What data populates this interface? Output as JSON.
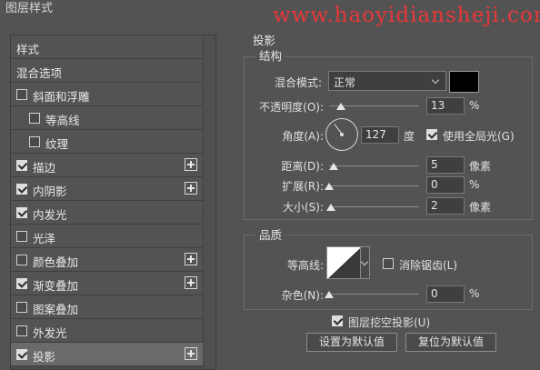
{
  "dialog": {
    "title": "图层样式",
    "watermark": "www.haoyidiansheji.com"
  },
  "style_list": [
    {
      "label": "样式",
      "has_checkbox": false,
      "checked": false,
      "has_plus": false,
      "selected": false,
      "indent": 0
    },
    {
      "label": "混合选项",
      "has_checkbox": false,
      "checked": false,
      "has_plus": false,
      "selected": false,
      "indent": 0
    },
    {
      "label": "斜面和浮雕",
      "has_checkbox": true,
      "checked": false,
      "has_plus": false,
      "selected": false,
      "indent": 0
    },
    {
      "label": "等高线",
      "has_checkbox": true,
      "checked": false,
      "has_plus": false,
      "selected": false,
      "indent": 1
    },
    {
      "label": "纹理",
      "has_checkbox": true,
      "checked": false,
      "has_plus": false,
      "selected": false,
      "indent": 1
    },
    {
      "label": "描边",
      "has_checkbox": true,
      "checked": true,
      "has_plus": true,
      "selected": false,
      "indent": 0
    },
    {
      "label": "内阴影",
      "has_checkbox": true,
      "checked": true,
      "has_plus": true,
      "selected": false,
      "indent": 0
    },
    {
      "label": "内发光",
      "has_checkbox": true,
      "checked": true,
      "has_plus": false,
      "selected": false,
      "indent": 0
    },
    {
      "label": "光泽",
      "has_checkbox": true,
      "checked": false,
      "has_plus": false,
      "selected": false,
      "indent": 0
    },
    {
      "label": "颜色叠加",
      "has_checkbox": true,
      "checked": false,
      "has_plus": true,
      "selected": false,
      "indent": 0
    },
    {
      "label": "渐变叠加",
      "has_checkbox": true,
      "checked": true,
      "has_plus": true,
      "selected": false,
      "indent": 0
    },
    {
      "label": "图案叠加",
      "has_checkbox": true,
      "checked": false,
      "has_plus": false,
      "selected": false,
      "indent": 0
    },
    {
      "label": "外发光",
      "has_checkbox": true,
      "checked": false,
      "has_plus": false,
      "selected": false,
      "indent": 0
    },
    {
      "label": "投影",
      "has_checkbox": true,
      "checked": true,
      "has_plus": true,
      "selected": true,
      "indent": 0
    }
  ],
  "drop_shadow": {
    "title": "投影",
    "structure": {
      "title": "结构",
      "blend_mode_label": "混合模式:",
      "blend_mode_value": "正常",
      "shadow_color": "#000000",
      "opacity_label": "不透明度(O):",
      "opacity_value": "13",
      "opacity_unit": "%",
      "opacity_level": 0.13,
      "angle_label": "角度(A):",
      "angle_value": "127",
      "angle_unit": "度",
      "global_light_label": "使用全局光(G)",
      "global_light_checked": true,
      "distance_label": "距离(D):",
      "distance_value": "5",
      "distance_unit": "像素",
      "distance_level": 0.05,
      "spread_label": "扩展(R):",
      "spread_value": "0",
      "spread_unit": "%",
      "spread_level": 0.0,
      "size_label": "大小(S):",
      "size_value": "2",
      "size_unit": "像素",
      "size_level": 0.02
    },
    "quality": {
      "title": "品质",
      "contour_label": "等高线:",
      "anti_alias_label": "消除锯齿(L)",
      "anti_alias_checked": false,
      "noise_label": "杂色(N):",
      "noise_value": "0",
      "noise_unit": "%",
      "noise_level": 0.0
    },
    "knockout_label": "图层挖空投影(U)",
    "knockout_checked": true,
    "make_default_label": "设置为默认值",
    "reset_default_label": "复位为默认值"
  }
}
